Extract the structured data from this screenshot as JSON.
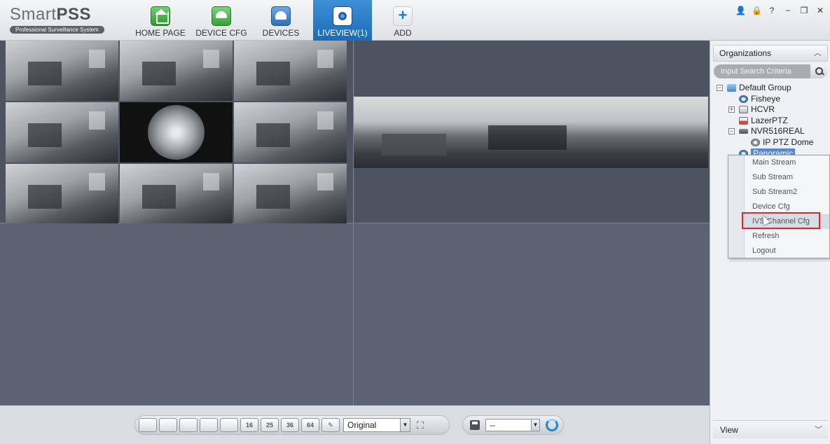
{
  "app": {
    "logo_main": "Smart",
    "logo_bold": "PSS",
    "logo_subtitle": "Professional Surveillance System"
  },
  "nav": [
    {
      "label": "HOME PAGE",
      "icon": "home-icon"
    },
    {
      "label": "DEVICE CFG",
      "icon": "device-cfg-icon"
    },
    {
      "label": "DEVICES",
      "icon": "devices-icon"
    },
    {
      "label": "LIVEVIEW(1)",
      "icon": "liveview-icon",
      "active": true
    },
    {
      "label": "ADD",
      "icon": "add-icon",
      "glyph": "+"
    }
  ],
  "window_controls": [
    "user-icon",
    "lock-icon",
    "help-icon",
    "minimize-icon",
    "restore-icon",
    "close-icon"
  ],
  "window_controls_glyphs": {
    "user": "👤",
    "lock": "🔒",
    "help": "?",
    "minimize": "−",
    "restore": "❐",
    "close": "✕"
  },
  "toolbar": {
    "layout_buttons": [
      "",
      "",
      "",
      "",
      "",
      "16",
      "25",
      "36",
      "64"
    ],
    "stream_select": "Original",
    "view_select": "--"
  },
  "panel": {
    "organizations_title": "Organizations",
    "search_placeholder": "Input Search Criteria",
    "view_footer": "View",
    "tree": [
      {
        "label": "Default Group",
        "icon": "group-icon",
        "expander": "−",
        "level": 0
      },
      {
        "label": "Fisheye",
        "icon": "fisheye-camera-icon",
        "level": 1
      },
      {
        "label": "HCVR",
        "icon": "dvr-icon",
        "expander": "+",
        "level": 1
      },
      {
        "label": "LazerPTZ",
        "icon": "ptz-icon",
        "level": 1
      },
      {
        "label": "NVR516REAL",
        "icon": "nvr-icon",
        "expander": "−",
        "level": 1
      },
      {
        "label": "IP PTZ Dome",
        "icon": "dome-camera-icon",
        "level": 2
      },
      {
        "label": "Panoramic",
        "icon": "panoramic-camera-icon",
        "level": 1,
        "selected": true
      }
    ]
  },
  "context_menu": {
    "items": [
      "Main Stream",
      "Sub Stream",
      "Sub Stream2",
      "Device Cfg",
      "IVS Channel Cfg",
      "Refresh",
      "Logout"
    ],
    "highlighted": "IVS Channel Cfg"
  },
  "colors": {
    "accent_blue": "#1c6bb8",
    "highlight_red": "#e0252b",
    "video_bg": "#5c6271"
  }
}
